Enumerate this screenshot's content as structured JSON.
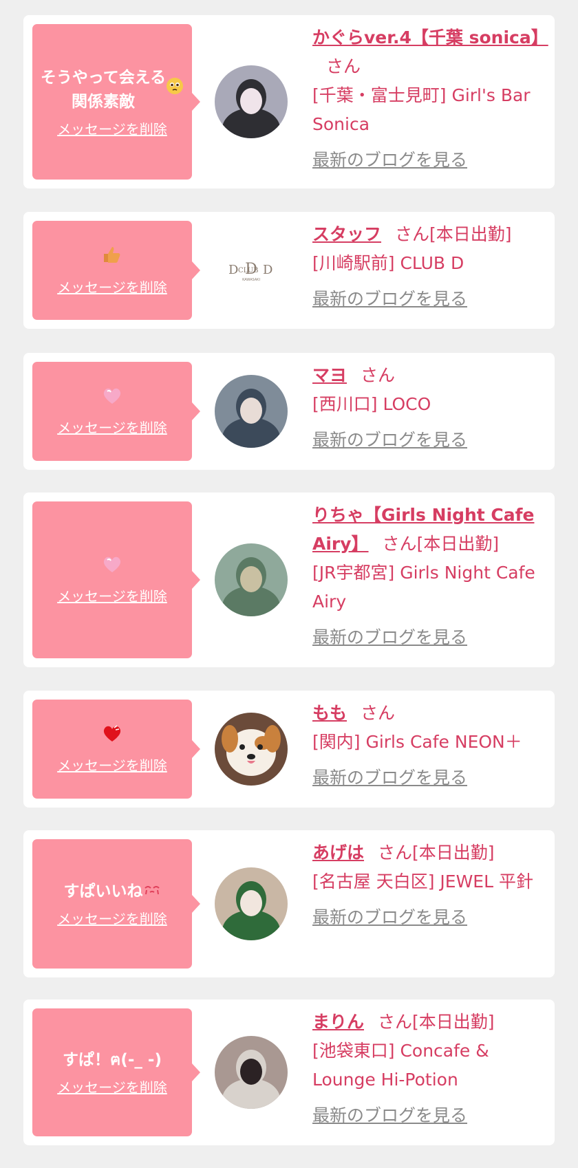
{
  "delete_label": "メッセージを削除",
  "blog_label": "最新のブログを見る",
  "san_label": "さん",
  "colors": {
    "bubble": "#fc93a1",
    "accent": "#d63d62",
    "link_gray": "#8a8a8a",
    "page_bg": "#efefef"
  },
  "messages": [
    {
      "bubble_text": "そうやって会える\n関係素敵",
      "bubble_icon": "pleading-face-emoji-icon",
      "cast_name": "かぐらver.4【千葉 sonica】",
      "status": "",
      "shop": "[千葉・富士見町] Girl's Bar Sonica",
      "avatar": "photo-avatar-icon"
    },
    {
      "bubble_text": "",
      "bubble_icon": "thumbs-up-emoji-icon",
      "cast_name": "スタッフ",
      "status": "[本日出勤]",
      "shop": "[川崎駅前] CLUB D",
      "avatar": "club-d-logo-icon"
    },
    {
      "bubble_text": "",
      "bubble_icon": "pink-heart-emoji-icon",
      "cast_name": "マヨ",
      "status": "",
      "shop": "[西川口] LOCO",
      "avatar": "photo-avatar-icon"
    },
    {
      "bubble_text": "",
      "bubble_icon": "pink-heart-emoji-icon",
      "cast_name": "りちゃ【Girls Night Cafe Airy】",
      "status": "[本日出勤]",
      "shop": "[JR宇都宮] Girls Night Cafe Airy",
      "avatar": "photo-avatar-icon"
    },
    {
      "bubble_text": "",
      "bubble_icon": "red-heart-emoji-icon",
      "cast_name": "もも",
      "status": "",
      "shop": "[関内] Girls Cafe NEON＋",
      "avatar": "dog-avatar-icon"
    },
    {
      "bubble_text": "すぱいいね",
      "bubble_icon": "crying-emoji-icon",
      "cast_name": "あげは",
      "status": "[本日出勤]",
      "shop": "[名古屋 天白区] JEWEL 平針",
      "avatar": "photo-avatar-icon"
    },
    {
      "bubble_text": "すぱ！ฅ(-_ -)",
      "bubble_icon": "",
      "cast_name": "まりん",
      "status": "[本日出勤]",
      "shop": "[池袋東口] Concafe & Lounge Hi-Potion",
      "avatar": "photo-avatar-icon"
    }
  ]
}
